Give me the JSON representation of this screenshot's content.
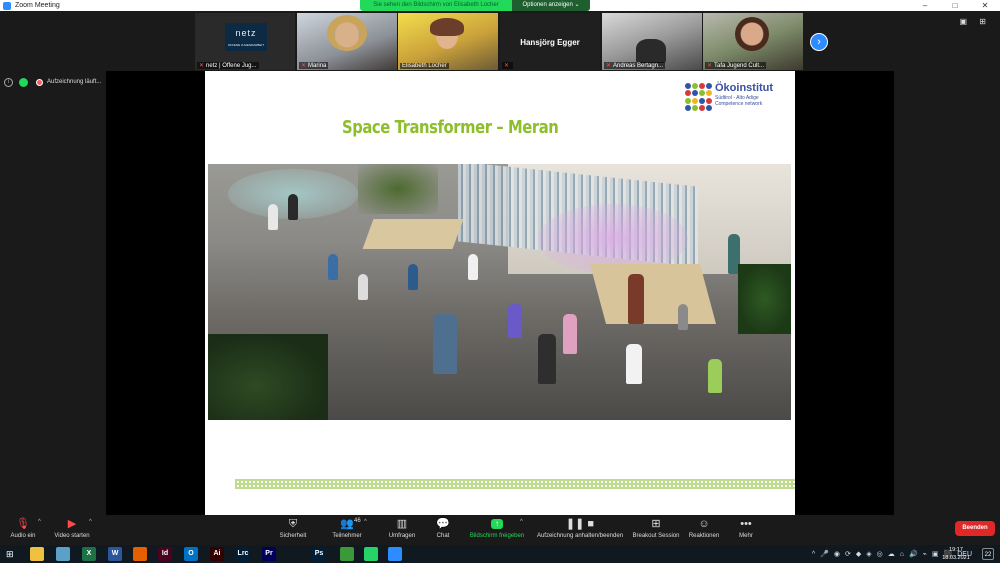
{
  "window": {
    "title": "Zoom Meeting",
    "controls": {
      "minimize": "–",
      "maximize": "□",
      "close": "✕"
    }
  },
  "share_banner": {
    "text": "Sie sehen den Bildschirm von Elisabeth Locher",
    "options_label": "Optionen anzeigen",
    "options_chevron": "⌄"
  },
  "participants": [
    {
      "name": "netz | Offene Jug...",
      "muted": true,
      "logo_text": "netz",
      "logo_sub": "OFFENE JUGENDARBEIT"
    },
    {
      "name": "Marina",
      "muted": true
    },
    {
      "name": "Elisabeth Locher",
      "muted": false
    },
    {
      "name": "Hansjörg Egger",
      "muted": true,
      "video_off": true
    },
    {
      "name": "Andreas Bertagn...",
      "muted": true
    },
    {
      "name": "Tafa Jugend Cult...",
      "muted": true
    }
  ],
  "strip": {
    "next_icon": "›",
    "view_icon": "▣",
    "layout_icon": "⊞",
    "mic_icon": "🎤"
  },
  "status": {
    "info_icon": "i",
    "recording_label": "Aufzeichnung läuft...",
    "pause_icon": "❚❚",
    "stop_icon": "■"
  },
  "slide": {
    "title": "Space Transformer – Meran",
    "brand_name": "Ökoinstitut",
    "brand_line1": "Südtirol - Alto Adige",
    "brand_line2": "Competence network",
    "brand_dot_colors": [
      "#2d56a6",
      "#8cbf2b",
      "#d63b3b",
      "#2d56a6",
      "#d63b3b",
      "#2d56a6",
      "#8cbf2b",
      "#f0b429",
      "#8cbf2b",
      "#f0b429",
      "#2d56a6",
      "#d63b3b",
      "#2d56a6",
      "#8cbf2b",
      "#d63b3b",
      "#2d56a6"
    ]
  },
  "toolbar": {
    "audio": {
      "label": "Audio ein",
      "icon": "🎙"
    },
    "video": {
      "label": "Video starten",
      "icon": "▶"
    },
    "chevron": "^",
    "items": [
      {
        "key": "security",
        "label": "Sicherheit",
        "icon": "⛨"
      },
      {
        "key": "participants",
        "label": "Teilnehmer",
        "icon": "👥",
        "count": "46"
      },
      {
        "key": "polls",
        "label": "Umfragen",
        "icon": "▥"
      },
      {
        "key": "chat",
        "label": "Chat",
        "icon": "💬"
      },
      {
        "key": "share",
        "label": "Bildschirm freigeben",
        "icon": "↑"
      },
      {
        "key": "record",
        "label": "Aufzeichnung anhalten/beenden",
        "icon": "❚❚ ■"
      },
      {
        "key": "breakout",
        "label": "Breakout Session",
        "icon": "⊞"
      },
      {
        "key": "reactions",
        "label": "Reaktionen",
        "icon": "☺"
      },
      {
        "key": "more",
        "label": "Mehr",
        "icon": "•••"
      }
    ],
    "end_label": "Beenden"
  },
  "taskbar": {
    "start_icon": "⊞",
    "apps": [
      {
        "name": "file-explorer",
        "label": "",
        "color": "#f0c040"
      },
      {
        "name": "files",
        "label": "",
        "color": "#5aa0c8"
      },
      {
        "name": "excel",
        "label": "X",
        "color": "#1e7145"
      },
      {
        "name": "word",
        "label": "W",
        "color": "#2b579a"
      },
      {
        "name": "firefox",
        "label": "",
        "color": "#e66000"
      },
      {
        "name": "indesign",
        "label": "Id",
        "color": "#49021f"
      },
      {
        "name": "illustrator",
        "label": "Ai",
        "color": "#330000"
      },
      {
        "name": "lightroom-classic",
        "label": "Lrc",
        "color": "#001e36"
      },
      {
        "name": "premiere",
        "label": "Pr",
        "color": "#00005b"
      },
      {
        "name": "outlook",
        "label": "O",
        "color": "#0072c6"
      },
      {
        "name": "photoshop",
        "label": "Ps",
        "color": "#001e36"
      },
      {
        "name": "green-app",
        "label": "",
        "color": "#3a9a3a"
      },
      {
        "name": "whatsapp",
        "label": "",
        "color": "#25d366"
      },
      {
        "name": "zoom",
        "label": "",
        "color": "#2d8cff"
      }
    ],
    "tray_icons": [
      "^",
      "🎤",
      "◉",
      "⟳",
      "◆",
      "◈",
      "◎",
      "☁",
      "⌂",
      "🔊",
      "⌁",
      "▣",
      "⬛",
      "DEU"
    ],
    "time": "19:17",
    "date": "18.03.2021",
    "notifications": "22"
  }
}
